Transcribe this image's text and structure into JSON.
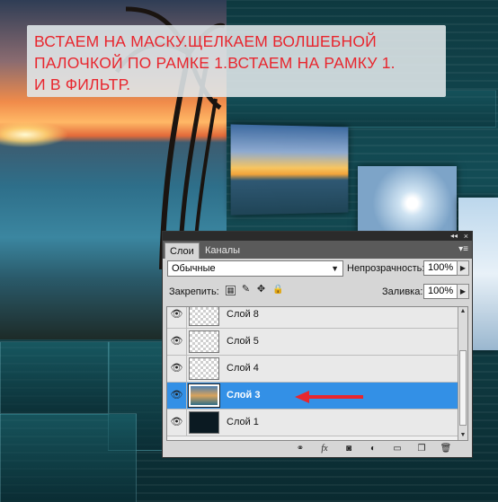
{
  "annotation": {
    "lines": [
      "ВСТАЕМ НА МАСКУ.ЩЕЛКАЕМ ВОЛШЕБНОЙ",
      "ПАЛОЧКОЙ ПО РАМКЕ 1.ВСТАЕМ НА РАМКУ 1.",
      "И В ФИЛЬТР."
    ],
    "color": "#e8262e"
  },
  "panel": {
    "tabs": [
      {
        "label": "Слои",
        "active": true
      },
      {
        "label": "Каналы",
        "active": false
      }
    ],
    "blend_mode": "Обычные",
    "opacity_label": "Непрозрачность:",
    "opacity_value": "100%",
    "lock_label": "Закрепить:",
    "fill_label": "Заливка:",
    "fill_value": "100%",
    "layers": [
      {
        "name": "Слой 8",
        "visible": true,
        "selected": false
      },
      {
        "name": "Слой 5",
        "visible": true,
        "selected": false
      },
      {
        "name": "Слой 4",
        "visible": true,
        "selected": false
      },
      {
        "name": "Слой 3",
        "visible": true,
        "selected": true
      },
      {
        "name": "Слой 1",
        "visible": true,
        "selected": false
      }
    ],
    "selected_color": "#3390e6",
    "bottom_icons": [
      "link-icon",
      "fx-icon",
      "mask-icon",
      "adjustment-icon",
      "group-icon",
      "new-layer-icon",
      "trash-icon"
    ]
  }
}
